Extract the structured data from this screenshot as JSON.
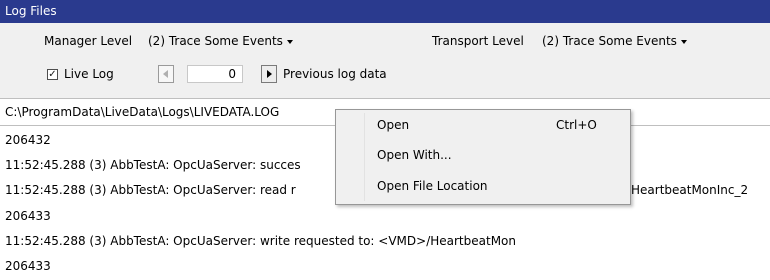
{
  "panel": {
    "title": "Log Files"
  },
  "settings": {
    "manager_label": "Manager Level",
    "manager_value": "(2) Trace Some Events",
    "transport_label": "Transport Level",
    "transport_value": "(2) Trace Some Events",
    "live_log_label": "Live Log",
    "live_log_checked": true,
    "index_value": "0",
    "previous_label": "Previous log data"
  },
  "path": "C:\\ProgramData\\LiveData\\Logs\\LIVEDATA.LOG",
  "log_lines": [
    "206432",
    "11:52:45.288 (3) AbbTestA: OpcUaServer: succes",
    "11:52:45.288 (3) AbbTestA: OpcUaServer: read r",
    "206433",
    "11:52:45.288 (3) AbbTestA: OpcUaServer: write requested to: <VMD>/HeartbeatMon",
    "206433"
  ],
  "log_line_overflow": "HeartbeatMonInc_2",
  "context_menu": [
    {
      "label": "Open",
      "shortcut": "Ctrl+O"
    },
    {
      "label": "Open With...",
      "shortcut": ""
    },
    {
      "label": "Open File Location",
      "shortcut": ""
    }
  ]
}
